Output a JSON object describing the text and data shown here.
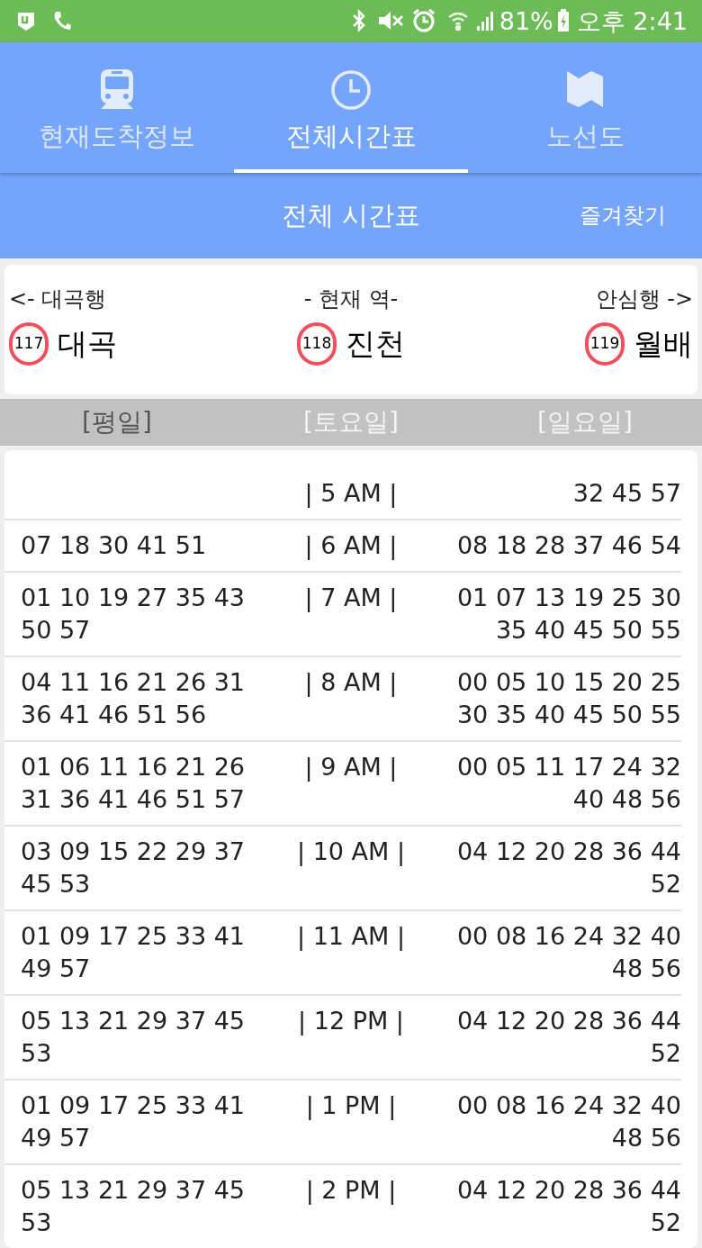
{
  "status_bar": {
    "battery": "81%",
    "time": "오후 2:41"
  },
  "tabs": [
    {
      "label": "현재도착정보",
      "kind": "train",
      "selected": false
    },
    {
      "label": "전체시간표",
      "kind": "clock",
      "selected": true
    },
    {
      "label": "노선도",
      "kind": "map",
      "selected": false
    }
  ],
  "header": {
    "title": "전체 시간표",
    "favorites": "즐겨찾기"
  },
  "stations": [
    {
      "direction": "<- 대곡행",
      "number": "117",
      "name": "대곡"
    },
    {
      "direction": "- 현재 역-",
      "number": "118",
      "name": "진천"
    },
    {
      "direction": "안심행 ->",
      "number": "119",
      "name": "월배"
    }
  ],
  "day_tabs": [
    {
      "label": "[평일]",
      "selected": true
    },
    {
      "label": "[토요일]",
      "selected": false
    },
    {
      "label": "[일요일]",
      "selected": false
    }
  ],
  "timetable": [
    {
      "hour": "| 5 AM |",
      "column_3": [
        "32 45 57"
      ]
    },
    {
      "column_1": [
        "07 18 30 41 51"
      ],
      "hour": "| 6 AM |",
      "column_3": [
        "08 18 28 37 46 54"
      ]
    },
    {
      "column_1": [
        "01 10 19 27 35 43",
        "50 57"
      ],
      "hour": "| 7 AM |",
      "column_3": [
        "01 07 13 19 25 30",
        "35 40 45 50 55"
      ]
    },
    {
      "column_1": [
        "04 11 16 21 26 31",
        "36 41 46 51 56"
      ],
      "hour": "| 8 AM |",
      "column_3": [
        "00 05 10 15 20 25",
        "30 35 40 45 50 55"
      ]
    },
    {
      "column_1": [
        "01 06 11 16 21 26",
        "31 36 41 46 51 57"
      ],
      "hour": "| 9 AM |",
      "column_3": [
        "00 05 11 17 24 32",
        "40 48 56"
      ]
    },
    {
      "column_1": [
        "03 09 15 22 29 37",
        "45 53"
      ],
      "hour": "| 10 AM |",
      "column_3": [
        "04 12 20 28 36 44",
        "52"
      ]
    },
    {
      "column_1": [
        "01 09 17 25 33 41",
        "49 57"
      ],
      "hour": "| 11 AM |",
      "column_3": [
        "00 08 16 24 32 40",
        "48 56"
      ]
    },
    {
      "column_1": [
        "05 13 21 29 37 45",
        "53"
      ],
      "hour": "| 12 PM |",
      "column_3": [
        "04 12 20 28 36 44",
        "52"
      ]
    },
    {
      "column_1": [
        "01 09 17 25 33 41",
        "49 57"
      ],
      "hour": "| 1 PM |",
      "column_3": [
        "00 08 16 24 32 40",
        "48 56"
      ]
    },
    {
      "column_1": [
        "05 13 21 29 37 45",
        "53"
      ],
      "hour": "| 2 PM |",
      "column_3": [
        "04 12 20 28 36 44",
        "52"
      ]
    }
  ]
}
